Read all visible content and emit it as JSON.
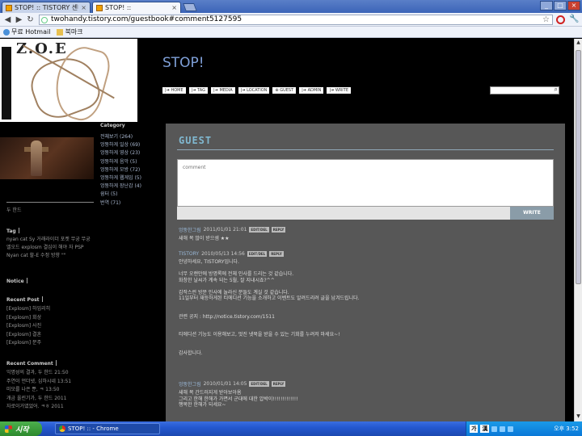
{
  "browser": {
    "tabs": [
      {
        "label": "STOP! :: TISTORY 센터",
        "active": false
      },
      {
        "label": "STOP! ::",
        "active": true
      }
    ],
    "url": "twohandy.tistory.com/guestbook#comment5127595",
    "bookmarks": [
      "무료 Hotmail",
      "북마크"
    ]
  },
  "blog": {
    "title": "STOP!",
    "menu": [
      "HOME",
      "TAG",
      "MEDIA",
      "LOCATION",
      "GUEST",
      "ADMIN",
      "WRITE"
    ],
    "header_logo": "Z.O.E"
  },
  "sidebar": {
    "category_title": "Category",
    "categories": [
      "전체보기 (264)",
      "엉뚱하게 일상 (69)",
      "엉뚱하게 영상 (23)",
      "엉뚱하게 음악 (5)",
      "엉뚱하게 모방 (72)",
      "엉뚱하게 웹게임 (5)",
      "엉뚱하게 장난감 (4)",
      "쉼터 (5)",
      "번역 (71)"
    ],
    "divider_label": "두 한드",
    "tag_title": "Tag",
    "tag_text": "nyan cat Sy 거래라이더 포켓 무궁 무궁 엘오드 explosm 결심이 해야 자 PSP Nyan cat 할-E 수정 방향 \"\"",
    "notice_title": "Notice",
    "recent_post_title": "Recent Post",
    "recent_posts": [
      "[Explosm] 하임리히",
      "[Explosm] 회상",
      "[Explosm] 사진",
      "[Explosm] 결혼",
      "[Explosm] 문주"
    ],
    "recent_comment_title": "Recent Comment",
    "recent_comments": [
      "익명성의 결과, 두 한드 21:50",
      "주연이 언더넷, 심하시네 13:51",
      "미모를 나은 뿐, ㅋ 13:50",
      "개금 올린기가, 두 한드 2011",
      "자로이거였었어. ㅋㅎ 2011"
    ]
  },
  "guestbook": {
    "title": "GUEST",
    "comment_placeholder": "comment",
    "write_label": "WRITE",
    "entries": [
      {
        "author": "엉뚱한그림",
        "date": "2011/01/01 21:01",
        "buttons": [
          "EDIT/DEL",
          "REPLY"
        ],
        "body": "새해 복 많이 받으셈 ★★"
      },
      {
        "author": "TISTORY",
        "date": "2010/05/13 14:56",
        "buttons": [
          "EDIT/DEL",
          "REPLY"
        ],
        "body": "안녕하세요, TISTORY입니다.\n\n너무 오랜만에 방명록에 전체 인사를 드리는 것 같습니다.\n화창한 날씨가 계속 되는 5월, 잘 지내시죠?^^\n\n갑작스런 방문 인사에 놀라신 분들도 계실 것 같습니다.\n11일부터 재등하게된 티에디션 기능을 소개하고 이벤트도 알려드리려 글을 남겨드립니다.\n\n\n관련 공지 : http://notice.tistory.com/1511\n\n\n티에디션 기능도 이용해보고, 멋진 넷북을 받을 수 있는 기회를 누려저 마세요~!\n\n\n감사합니다."
      },
      {
        "author": "엉뚱한그림",
        "date": "2010/01/01 14:05",
        "buttons": [
          "EDIT/DEL",
          "REPLY"
        ],
        "body": "새해 복 간드러지게 받아보아욤\n그리고 한해 한해가 가면서 군대에 대한 압박이!!!!!!!!!!!!!\n행복한 한해가 되세요~"
      }
    ]
  },
  "taskbar": {
    "start_label": "시작",
    "task_label": "STOP! :: - Chrome",
    "ime_label": "가",
    "ime_label2": "漢",
    "clock": "오후 3:52"
  },
  "colors": {
    "page_bg": "#000000",
    "panel_bg": "#575757",
    "link_blue": "#7fa0d8",
    "guest_title": "#80b8d0"
  }
}
